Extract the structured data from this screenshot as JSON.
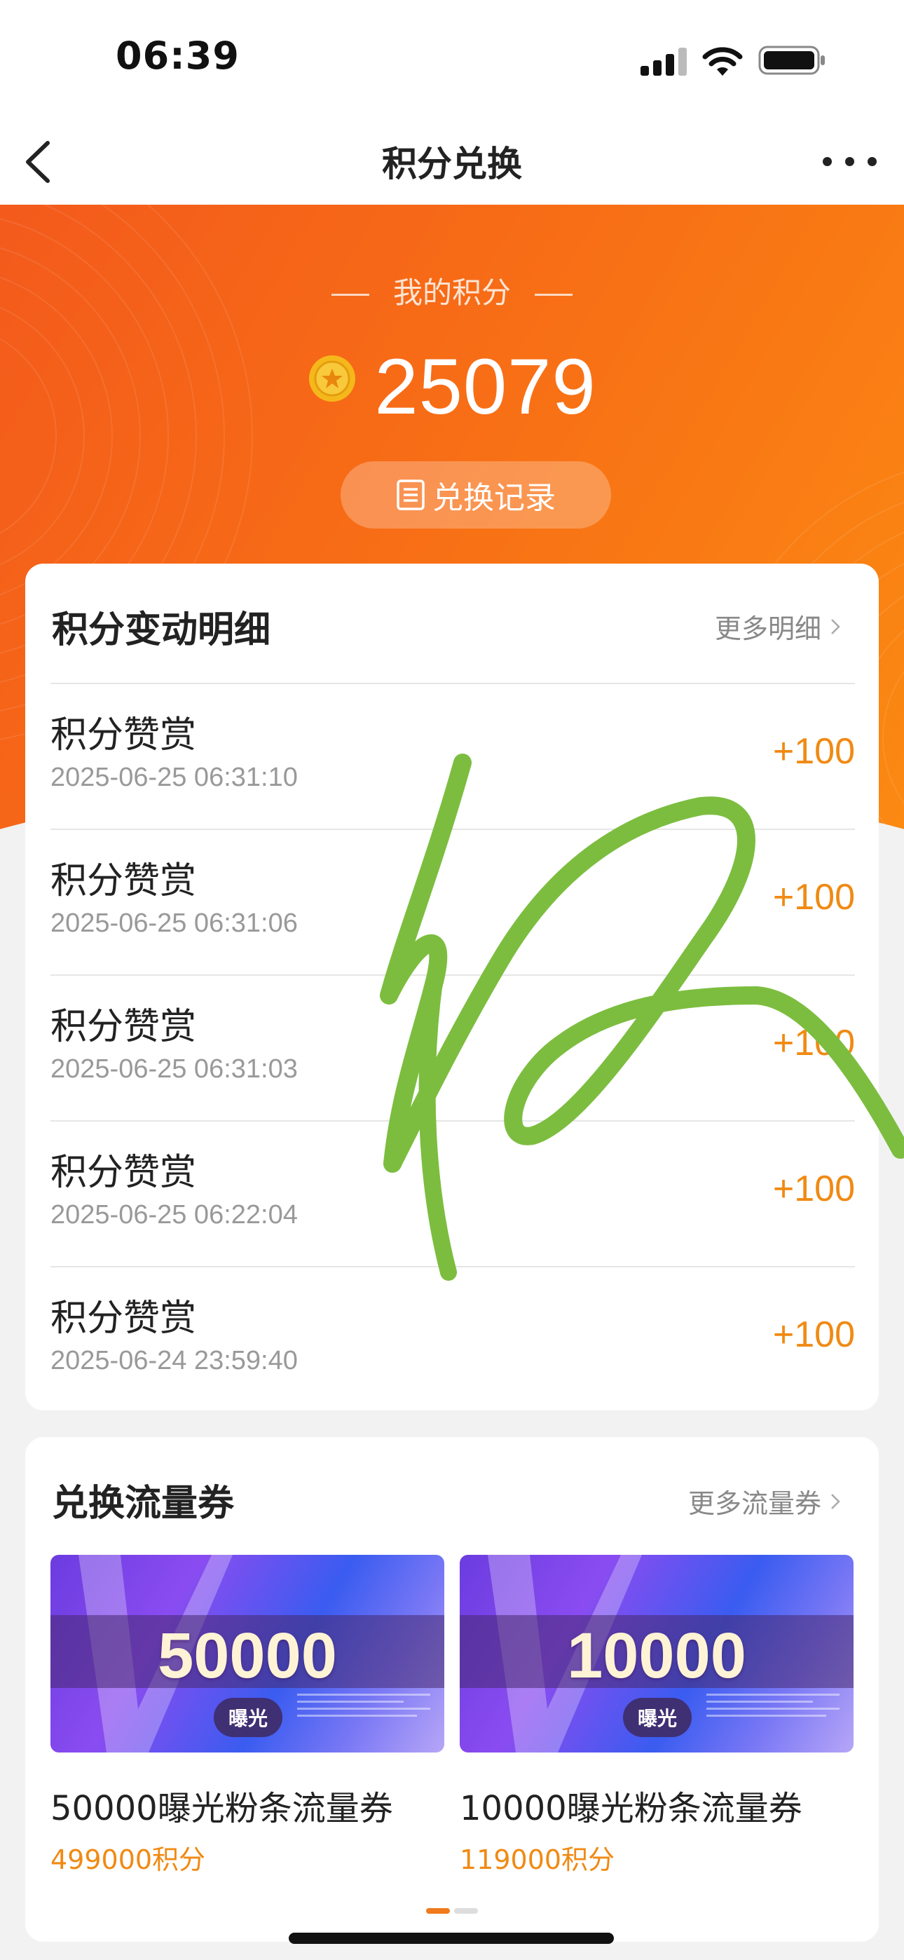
{
  "status_bar": {
    "time": "06:39"
  },
  "nav": {
    "title": "积分兑换"
  },
  "hero": {
    "label": "我的积分",
    "points": "25079",
    "records_button": "兑换记录"
  },
  "points_card": {
    "title": "积分变动明细",
    "more": "更多明细",
    "transactions": [
      {
        "title": "积分赞赏",
        "time": "2025-06-25 06:31:10",
        "amount": "+100"
      },
      {
        "title": "积分赞赏",
        "time": "2025-06-25 06:31:06",
        "amount": "+100"
      },
      {
        "title": "积分赞赏",
        "time": "2025-06-25 06:31:03",
        "amount": "+100"
      },
      {
        "title": "积分赞赏",
        "time": "2025-06-25 06:22:04",
        "amount": "+100"
      },
      {
        "title": "积分赞赏",
        "time": "2025-06-24 23:59:40",
        "amount": "+100"
      }
    ]
  },
  "coupons_card": {
    "title": "兑换流量券",
    "more": "更多流量券",
    "coupons": [
      {
        "amount": "50000",
        "badge": "曝光",
        "name": "50000曝光粉条流量券",
        "price": "499000积分"
      },
      {
        "amount": "10000",
        "badge": "曝光",
        "name": "10000曝光粉条流量券",
        "price": "119000积分"
      }
    ]
  },
  "colors": {
    "accent": "#f08a13",
    "hero_start": "#f35a1c",
    "hero_end": "#fb8a12",
    "overlay_stroke": "#7cbd3f"
  }
}
